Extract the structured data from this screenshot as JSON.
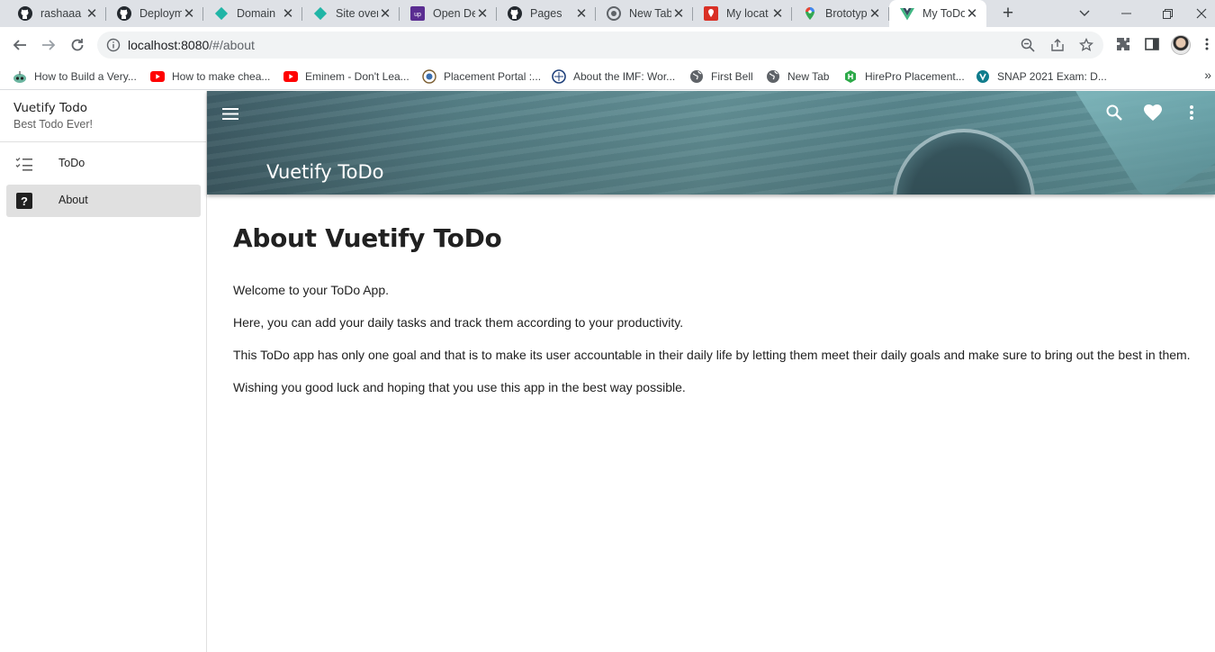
{
  "browser": {
    "tabs": [
      {
        "title": "rashaaa",
        "icon": "github-icon"
      },
      {
        "title": "Deploym",
        "icon": "github-icon"
      },
      {
        "title": "Domain",
        "icon": "netlify-icon"
      },
      {
        "title": "Site over",
        "icon": "netlify-icon"
      },
      {
        "title": "Open De",
        "icon": "upwork-icon"
      },
      {
        "title": "Pages",
        "icon": "github-icon"
      },
      {
        "title": "New Tab",
        "icon": "chrome-icon"
      },
      {
        "title": "My locat",
        "icon": "maps-pin-icon"
      },
      {
        "title": "Brototyp",
        "icon": "google-maps-icon"
      },
      {
        "title": "My ToDo",
        "icon": "vue-icon"
      }
    ],
    "new_tab_label": "+",
    "url_host": "localhost:8080",
    "url_path": "/#/about",
    "bookmarks": [
      {
        "label": "How to Build a Very...",
        "icon": "robot-icon"
      },
      {
        "label": "How to make chea...",
        "icon": "youtube-icon"
      },
      {
        "label": "Eminem - Don't Lea...",
        "icon": "youtube-icon"
      },
      {
        "label": "Placement Portal :...",
        "icon": "college-logo-icon"
      },
      {
        "label": "About the IMF: Wor...",
        "icon": "imf-logo-icon"
      },
      {
        "label": "First Bell",
        "icon": "globe-icon"
      },
      {
        "label": "New Tab",
        "icon": "globe-icon"
      },
      {
        "label": "HirePro Placement...",
        "icon": "hirepro-icon"
      },
      {
        "label": "SNAP 2021 Exam: D...",
        "icon": "snap-icon"
      }
    ],
    "bookmarks_more": "»"
  },
  "drawer": {
    "title": "Vuetify Todo",
    "subtitle": "Best Todo Ever!",
    "items": [
      {
        "label": "ToDo",
        "icon": "format-list-checks-icon",
        "active": false
      },
      {
        "label": "About",
        "icon": "help-box-icon",
        "active": true
      }
    ]
  },
  "appbar": {
    "title": "Vuetify ToDo"
  },
  "page": {
    "heading": "About Vuetify ToDo",
    "paragraphs": [
      "Welcome to your ToDo App.",
      "Here, you can add your daily tasks and track them according to your productivity.",
      "This ToDo app has only one goal and that is to make its user accountable in their daily life by letting them meet their daily goals and make sure to bring out the best in them.",
      "Wishing you good luck and hoping that you use this app in the best way possible."
    ]
  },
  "colors": {
    "tabstrip": "#dee1e6",
    "drawer_active": "#e0e0e0",
    "appbar_teal": "#5d8a92"
  }
}
